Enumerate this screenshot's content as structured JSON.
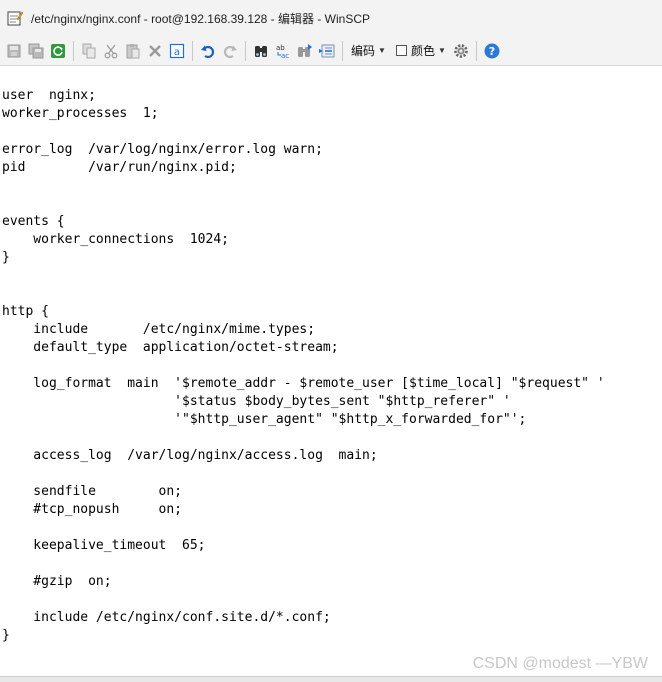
{
  "window": {
    "title": "/etc/nginx/nginx.conf - root@192.168.39.128 - 编辑器 - WinSCP"
  },
  "toolbar": {
    "buttons": [
      {
        "name": "save-icon"
      },
      {
        "name": "save-all-icon"
      },
      {
        "name": "reload-icon"
      },
      {
        "name": "copy-icon"
      },
      {
        "name": "cut-icon"
      },
      {
        "name": "paste-icon"
      },
      {
        "name": "delete-icon"
      },
      {
        "name": "select-all-icon"
      },
      {
        "name": "undo-icon"
      },
      {
        "name": "redo-icon"
      },
      {
        "name": "find-icon"
      },
      {
        "name": "replace-icon"
      },
      {
        "name": "find-next-icon"
      },
      {
        "name": "goto-line-icon"
      }
    ],
    "encoding_label": "编码",
    "color_label": "颜色",
    "settings_icon": "gear-icon",
    "help_icon": "help-icon"
  },
  "editor": {
    "lines": [
      "user  nginx;",
      "worker_processes  1;",
      "",
      "error_log  /var/log/nginx/error.log warn;",
      "pid        /var/run/nginx.pid;",
      "",
      "",
      "events {",
      "    worker_connections  1024;",
      "}",
      "",
      "",
      "http {",
      "    include       /etc/nginx/mime.types;",
      "    default_type  application/octet-stream;",
      "",
      "    log_format  main  '$remote_addr - $remote_user [$time_local] \"$request\" '",
      "                      '$status $body_bytes_sent \"$http_referer\" '",
      "                      '\"$http_user_agent\" \"$http_x_forwarded_for\"';",
      "",
      "    access_log  /var/log/nginx/access.log  main;",
      "",
      "    sendfile        on;",
      "    #tcp_nopush     on;",
      "",
      "    keepalive_timeout  65;",
      "",
      "    #gzip  on;",
      "",
      "    include /etc/nginx/conf.site.d/*.conf;",
      "}"
    ]
  },
  "watermark": "CSDN @modest —YBW",
  "colors": {
    "chrome_bg": "#f3f3f3",
    "editor_bg": "#ffffff",
    "accent_blue": "#1e6fd9",
    "help_blue": "#2a7ad8"
  }
}
